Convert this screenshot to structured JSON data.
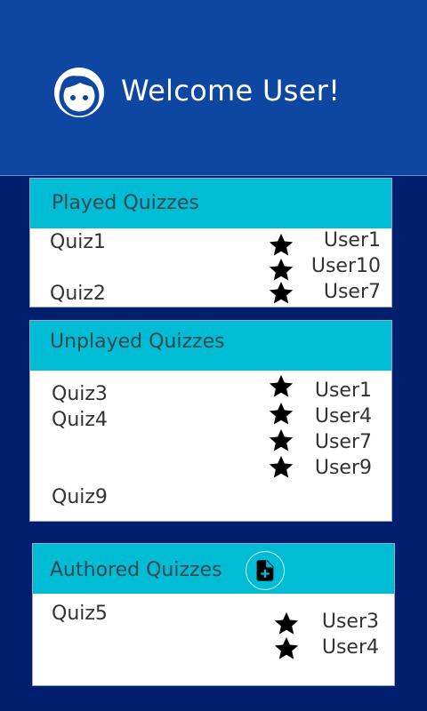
{
  "header": {
    "title": "Welcome User!",
    "avatar_icon": "face-icon"
  },
  "played": {
    "title": "Played Quizzes",
    "quizzes": [
      "Quiz1",
      "Quiz2"
    ],
    "users": [
      "User1",
      "User10",
      "User7"
    ]
  },
  "unplayed": {
    "title": "Unplayed Quizzes",
    "quizzes": [
      "Quiz3",
      "Quiz4",
      "Quiz9"
    ],
    "users": [
      "User1",
      "User4",
      "User7",
      "User9"
    ]
  },
  "authored": {
    "title": "Authored Quizzes",
    "add_icon": "note-add-icon",
    "quizzes": [
      "Quiz5"
    ],
    "users": [
      "User3",
      "User4"
    ]
  },
  "colors": {
    "background": "#021f6e",
    "header": "#0d47a1",
    "card_header": "#00bcd4"
  }
}
